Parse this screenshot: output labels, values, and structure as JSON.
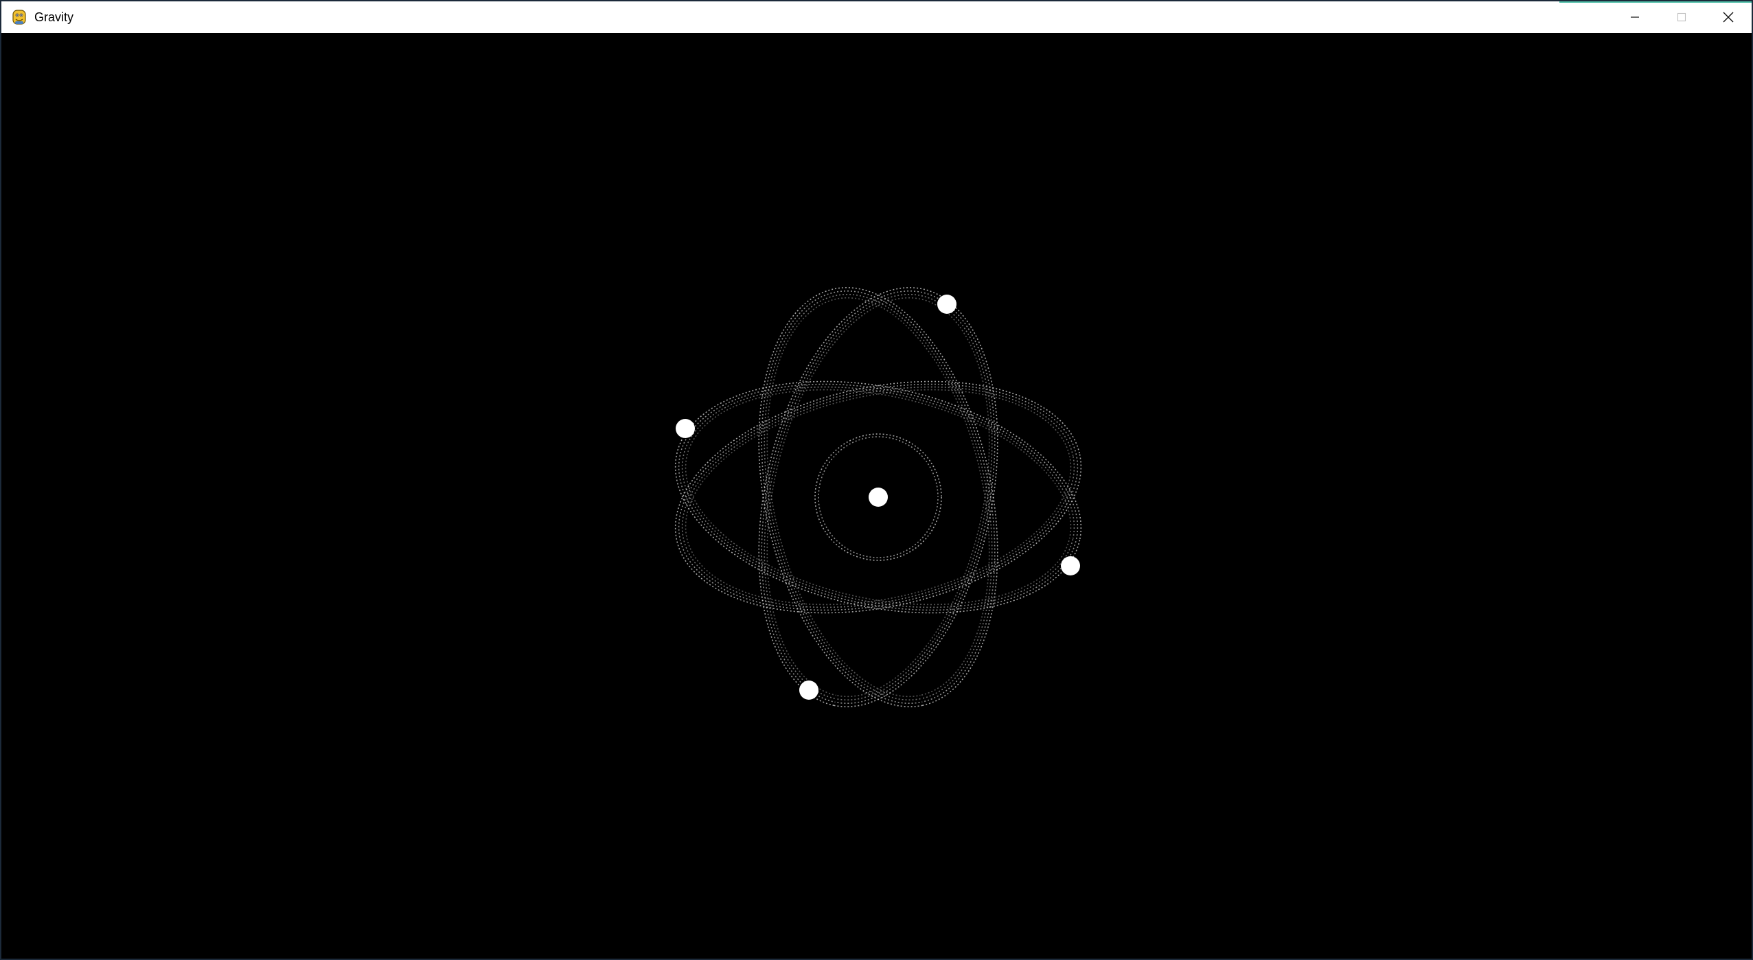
{
  "window": {
    "title": "Gravity",
    "app_icon": "python-snake-icon",
    "controls": {
      "minimize_icon": "minimize-icon",
      "maximize_icon": "maximize-icon",
      "close_icon": "close-icon"
    }
  },
  "simulation": {
    "background_color": "#000000",
    "trail_color": "#d9d9d9",
    "body_color": "#ffffff",
    "central_body": "sun",
    "orbiting_bodies": 5
  }
}
